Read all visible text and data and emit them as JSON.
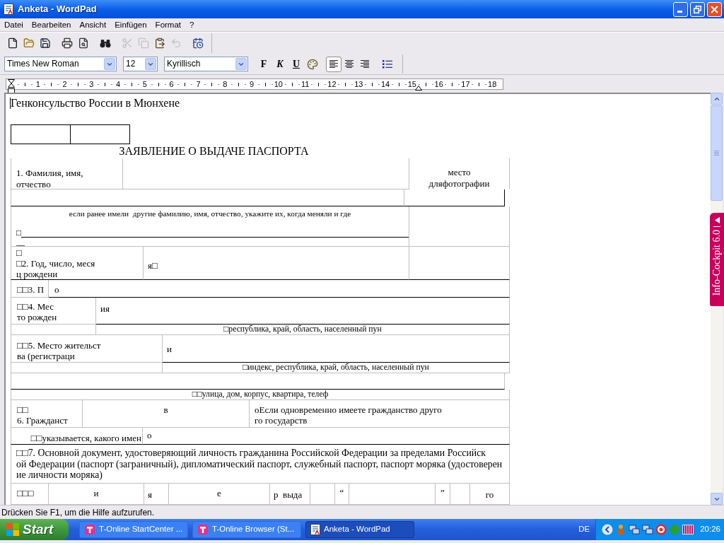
{
  "window": {
    "title": "Anketa - WordPad"
  },
  "menu": [
    "Datei",
    "Bearbeiten",
    "Ansicht",
    "Einfügen",
    "Format",
    "?"
  ],
  "toolbar": [
    [
      {
        "kind": "new",
        "disabled": false
      },
      {
        "kind": "open",
        "disabled": false
      },
      {
        "kind": "save",
        "disabled": false
      }
    ],
    [
      {
        "kind": "print",
        "disabled": false
      },
      {
        "kind": "preview",
        "disabled": false
      }
    ],
    [
      {
        "kind": "find",
        "disabled": false
      }
    ],
    [
      {
        "kind": "cut",
        "disabled": true
      },
      {
        "kind": "copy",
        "disabled": true
      },
      {
        "kind": "paste",
        "disabled": false
      },
      {
        "kind": "undo",
        "disabled": true
      }
    ],
    [
      {
        "kind": "datetime",
        "disabled": false
      }
    ]
  ],
  "format_bar": {
    "font": "Times New Roman",
    "size": "12",
    "script": "Kyrillisch",
    "styles": [
      {
        "kind": "bold",
        "label": "F"
      },
      {
        "kind": "italic",
        "label": "K"
      },
      {
        "kind": "underline",
        "label": "U"
      },
      {
        "kind": "color"
      }
    ],
    "alignment": [
      {
        "kind": "left",
        "selected": true
      },
      {
        "kind": "center",
        "selected": false
      },
      {
        "kind": "right",
        "selected": false
      }
    ]
  },
  "ruler": {
    "marks": [
      "1",
      "2",
      "3",
      "4",
      "5",
      "6",
      "7",
      "8",
      "9",
      "10",
      "11",
      "12",
      "13",
      "14",
      "15",
      "16",
      "17",
      "18"
    ]
  },
  "document": {
    "heading": "Генконсульство России в Мюнхене",
    "title": "ЗАЯВЛЕНИЕ О ВЫДАЧЕ ПАСПОРТА",
    "rows": [
      {
        "kind": "name",
        "cells": [
          "1. Фамилия, имя, отчество",
          "место дляфотографии"
        ]
      },
      {
        "kind": "name_extra"
      },
      {
        "kind": "former_names",
        "cells": [
          "если ранее имели  другие фамилию, имя, отчество, укажите их, когда меняли и где",
          "□",
          "__"
        ]
      },
      {
        "kind": "birth_date",
        "cells": [
          "□\n□2. Год, число, меся\nц рождени",
          "я□"
        ]
      },
      {
        "kind": "sex",
        "cells": [
          "□□3. П",
          "о"
        ]
      },
      {
        "kind": "birth_place",
        "cells": [
          "□□4. Мес\nто рожден",
          "ия"
        ]
      },
      {
        "kind": "birth_place_hint",
        "cells": [
          "□республика, край, область, населенный пун"
        ]
      },
      {
        "kind": "residence",
        "cells": [
          "□□5. Место жительст\nва (регистраци",
          "и"
        ]
      },
      {
        "kind": "residence_hint",
        "cells": [
          "□индекс, республика, край, область, населенный пун"
        ]
      },
      {
        "kind": "address_blank"
      },
      {
        "kind": "address_hint",
        "cells": [
          "□□улица, дом, корпус, квартира, телеф"
        ]
      },
      {
        "kind": "citizenship",
        "cells": [
          "□□\n6. Гражданст",
          "в",
          "оЕсли одновременно имеете гражданство друго\nго государств"
        ]
      },
      {
        "kind": "citizenship_note",
        "cells": [
          "□□указывается, какого имен",
          "о"
        ]
      },
      {
        "kind": "document",
        "cells": [
          "□□7. Основной документ, удостоверяющий личность гражданина Российской Федерации за пределами Российск\nой Федерации (паспорт (заграничный), дипломатический паспорт, служебный паспорт, паспорт моряка (удостоверен\nие личности моряка)"
        ]
      },
      {
        "kind": "document_details",
        "cells": [
          "□□□",
          "и",
          "я",
          "е",
          "р  выда",
          "“",
          "”",
          "го"
        ]
      }
    ]
  },
  "side_tab": {
    "label": "Info-Cockpit 6.0"
  },
  "status_bar": "Drücken Sie F1, um die Hilfe aufzurufen.",
  "taskbar": {
    "start": "Start",
    "tasks": [
      {
        "label": "T-Online StartCenter ...",
        "selected": false
      },
      {
        "label": "T-Online Browser (St...",
        "selected": false
      },
      {
        "label": "Anketa - WordPad",
        "selected": true
      }
    ],
    "language": "DE",
    "clock": "20:26"
  }
}
